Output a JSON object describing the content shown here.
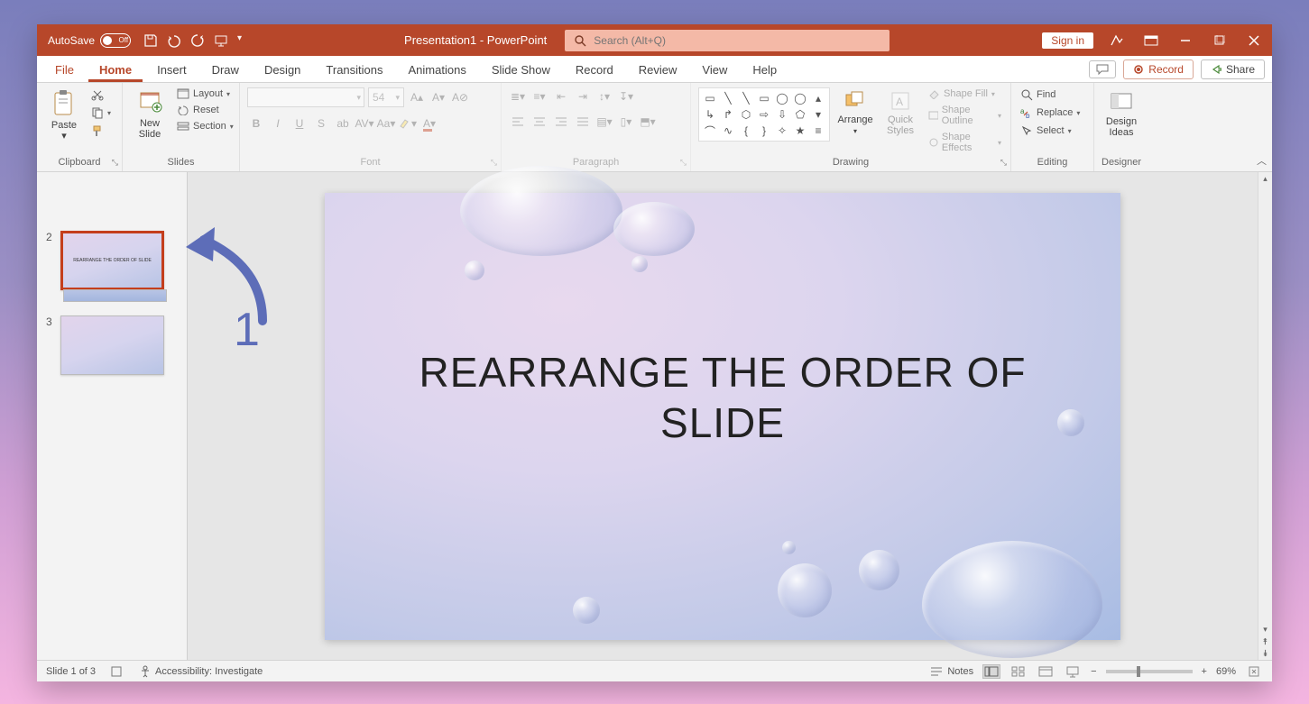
{
  "titlebar": {
    "autosave_label": "AutoSave",
    "autosave_state": "Off",
    "document_title": "Presentation1  -  PowerPoint",
    "search_placeholder": "Search (Alt+Q)",
    "sign_in": "Sign in"
  },
  "tabs": {
    "file": "File",
    "home": "Home",
    "insert": "Insert",
    "draw": "Draw",
    "design": "Design",
    "transitions": "Transitions",
    "animations": "Animations",
    "slideshow": "Slide Show",
    "record": "Record",
    "review": "Review",
    "view": "View",
    "help": "Help",
    "record_btn": "Record",
    "share_btn": "Share"
  },
  "ribbon": {
    "clipboard": {
      "label": "Clipboard",
      "paste": "Paste"
    },
    "slides": {
      "label": "Slides",
      "new_slide": "New\nSlide",
      "layout": "Layout",
      "reset": "Reset",
      "section": "Section"
    },
    "font": {
      "label": "Font",
      "size": "54"
    },
    "paragraph": {
      "label": "Paragraph"
    },
    "drawing": {
      "label": "Drawing",
      "arrange": "Arrange",
      "quick_styles": "Quick\nStyles",
      "shape_fill": "Shape Fill",
      "shape_outline": "Shape Outline",
      "shape_effects": "Shape Effects"
    },
    "editing": {
      "label": "Editing",
      "find": "Find",
      "replace": "Replace",
      "select": "Select"
    },
    "designer": {
      "label": "Designer",
      "design_ideas": "Design\nIdeas"
    }
  },
  "thumbnails": [
    {
      "number": "2",
      "text": "REARRANGE THE ORDER OF SLIDE",
      "selected": true,
      "has_peek": true
    },
    {
      "number": "3",
      "text": "",
      "selected": false,
      "has_peek": false
    }
  ],
  "annotation": {
    "number": "1"
  },
  "slide": {
    "title_line1": "REARRANGE THE ORDER OF",
    "title_line2": "SLIDE"
  },
  "status": {
    "slide_pos": "Slide 1 of 3",
    "accessibility": "Accessibility: Investigate",
    "notes": "Notes",
    "zoom": "69%"
  },
  "colors": {
    "accent": "#b7472a"
  }
}
